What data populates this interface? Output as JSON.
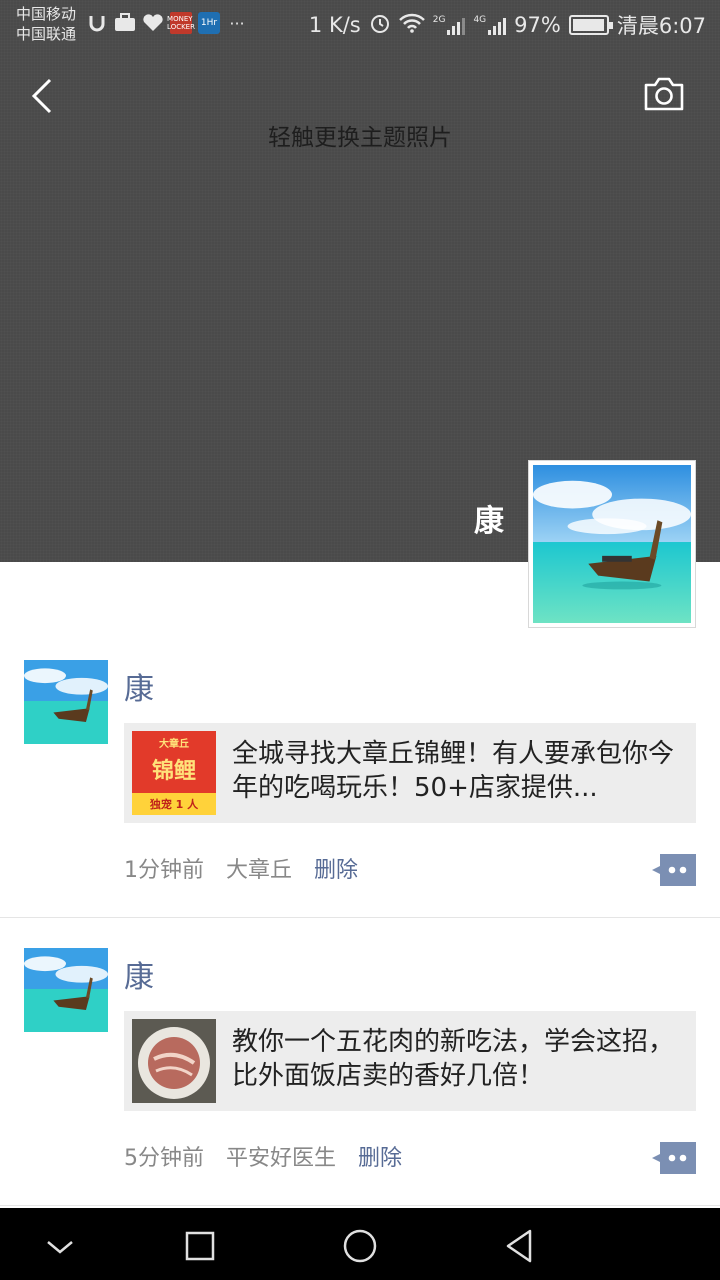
{
  "status_bar": {
    "carrier_1": "中国移动",
    "carrier_2": "中国联通",
    "app_icons": [
      "u-icon",
      "briefcase-icon",
      "heart-icon",
      "money-locker-icon",
      "home-icon"
    ],
    "money_locker_label": "MONEY LOCKER",
    "app_home_label": "1Hr",
    "more": "···",
    "network_speed": "1 K/s",
    "signal_2g": "2G",
    "signal_4g": "4G",
    "battery": "97%",
    "time": "清晨6:07"
  },
  "header": {
    "cover_hint": "轻触更换主题照片"
  },
  "profile": {
    "name": "康"
  },
  "posts": [
    {
      "author": "康",
      "share_text": "全城寻找大章丘锦鲤！有人要承包你今年的吃喝玩乐！50+店家提供...",
      "thumb_label_top": "大章丘",
      "thumb_label_main": "锦鲤",
      "thumb_label_bottom": "独宠 1 人",
      "time": "1分钟前",
      "location": "大章丘",
      "delete_label": "删除"
    },
    {
      "author": "康",
      "share_text": "教你一个五花肉的新吃法，学会这招，比外面饭店卖的香好几倍！",
      "time": "5分钟前",
      "location": "平安好医生",
      "delete_label": "删除"
    }
  ],
  "colors": {
    "link": "#576b95",
    "cover_bg": "#4a4a4a",
    "share_bg": "#ededed"
  }
}
